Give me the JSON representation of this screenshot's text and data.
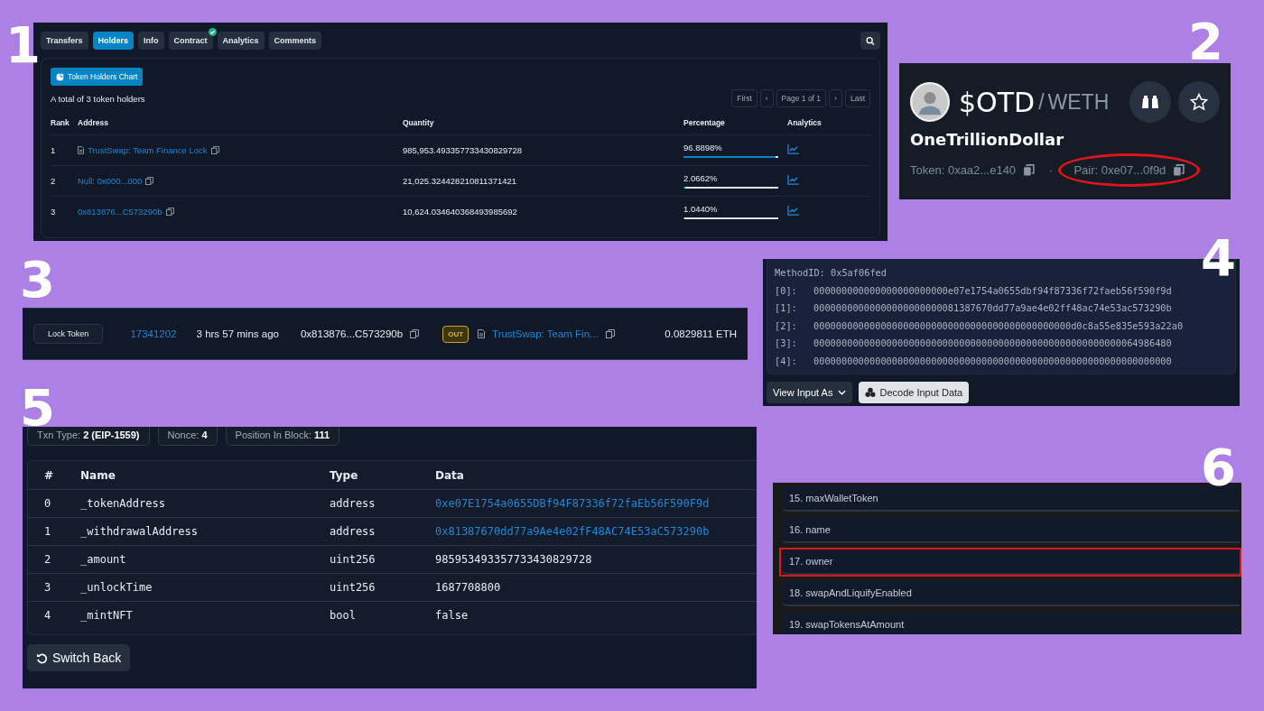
{
  "section_numbers": [
    "1",
    "2",
    "3",
    "4",
    "5",
    "6"
  ],
  "holders": {
    "tabs": [
      {
        "label": "Transfers",
        "selected": false,
        "verified": false
      },
      {
        "label": "Holders",
        "selected": true,
        "verified": false
      },
      {
        "label": "Info",
        "selected": false,
        "verified": false
      },
      {
        "label": "Contract",
        "selected": false,
        "verified": true
      },
      {
        "label": "Analytics",
        "selected": false,
        "verified": false
      },
      {
        "label": "Comments",
        "selected": false,
        "verified": false
      }
    ],
    "chart_button": "Token Holders Chart",
    "total": "A total of 3 token holders",
    "pagination": [
      "First",
      "‹",
      "Page 1 of 1",
      "›",
      "Last"
    ],
    "columns": [
      "Rank",
      "Address",
      "Quantity",
      "Percentage",
      "Analytics"
    ],
    "rows": [
      {
        "rank": "1",
        "address": "TrustSwap: Team Finance Lock",
        "contract": true,
        "quantity": "985,953.493357733430829728",
        "percentage": "96.8898%",
        "level": 0.968898
      },
      {
        "rank": "2",
        "address": "Null: 0x000...000",
        "contract": false,
        "quantity": "21,025.324428210811371421",
        "percentage": "2.0662%",
        "level": 0.020662
      },
      {
        "rank": "3",
        "address": "0x813876...C573290b",
        "contract": false,
        "quantity": "10,624.034640368493985692",
        "percentage": "1.0440%",
        "level": 0.01044
      }
    ]
  },
  "pair_card": {
    "symbol": "$OTD",
    "separator": "/",
    "quote": "WETH",
    "name": "OneTrillionDollar",
    "dot": "·",
    "addresses": [
      {
        "text": "Token: 0xaa2...e140",
        "highlighted": false
      },
      {
        "text": "Pair: 0xe07...0f9d",
        "highlighted": true
      }
    ]
  },
  "transaction": {
    "method": "Lock Token",
    "block": "17341202",
    "age": "3 hrs 57 mins ago",
    "from": "0x813876...C573290b",
    "direction": "OUT",
    "to": "TrustSwap: Team Fin...",
    "value": "0.0829811 ETH"
  },
  "input_data": {
    "method_id": "MethodID: 0x5af06fed",
    "params": [
      {
        "index": "[0]:",
        "value": "000000000000000000000000e07e1754a0655dbf94f87336f72faeb56f590f9d"
      },
      {
        "index": "[1]:",
        "value": "00000000000000000000000081387670dd77a9ae4e02ff48ac74e53ac573290b"
      },
      {
        "index": "[2]:",
        "value": "0000000000000000000000000000000000000000000000d0c8a55e835e593a22a0"
      },
      {
        "index": "[3]:",
        "value": "0000000000000000000000000000000000000000000000000000000064986480"
      },
      {
        "index": "[4]:",
        "value": "0000000000000000000000000000000000000000000000000000000000000000"
      }
    ],
    "view_button": "View Input As",
    "decode_button": "Decode Input Data"
  },
  "decoded": {
    "chips": [
      "Txn Type: **2 (EIP-1559)**",
      "Nonce: **4**",
      "Position In Block: **111**"
    ],
    "columns": [
      "#",
      "Name",
      "Type",
      "Data"
    ],
    "rows": [
      {
        "index": "0",
        "name": "_tokenAddress",
        "type": "address",
        "data": "0xe07E1754a0655DBf94F87336f72faEb56F590F9d",
        "link": true
      },
      {
        "index": "1",
        "name": "_withdrawalAddress",
        "type": "address",
        "data": "0x81387670dd77a9Ae4e02fF48AC74E53aC573290b",
        "link": true
      },
      {
        "index": "2",
        "name": "_amount",
        "type": "uint256",
        "data": "985953493357733430829728",
        "link": false
      },
      {
        "index": "3",
        "name": "_unlockTime",
        "type": "uint256",
        "data": "1687708800",
        "link": false
      },
      {
        "index": "4",
        "name": "_mintNFT",
        "type": "bool",
        "data": "false",
        "link": false
      }
    ],
    "switch_button": "Switch Back"
  },
  "functions": [
    {
      "label": "15. maxWalletToken",
      "highlighted": false
    },
    {
      "label": "16. name",
      "highlighted": false
    },
    {
      "label": "17. owner",
      "highlighted": true
    },
    {
      "label": "18. swapAndLiquifyEnabled",
      "highlighted": false
    },
    {
      "label": "19. swapTokensAtAmount",
      "highlighted": false
    }
  ]
}
